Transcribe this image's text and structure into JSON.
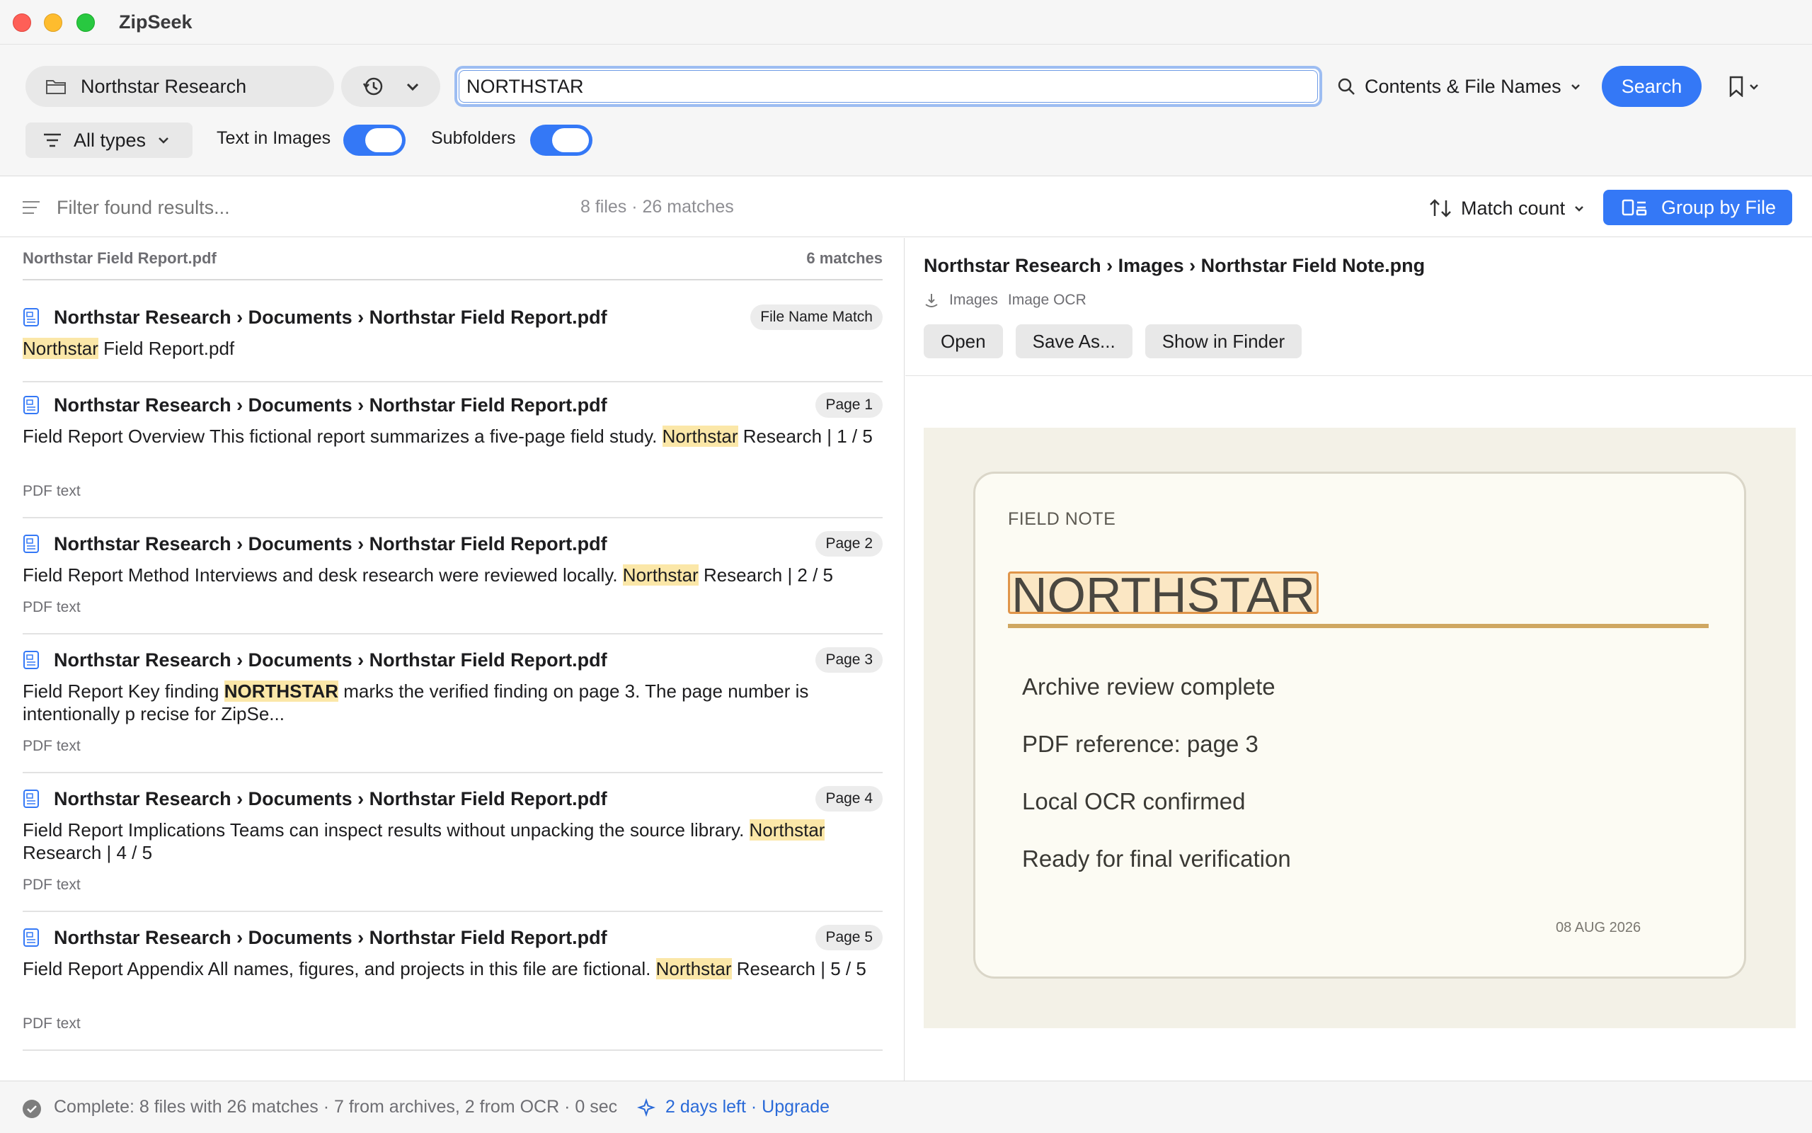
{
  "app": {
    "title": "ZipSeek"
  },
  "toolbar": {
    "location": "Northstar Research",
    "search_value": "NORTHSTAR",
    "scope_label": "Contents & File Names",
    "search_label": "Search",
    "types_label": "All types",
    "text_in_images_label": "Text in Images",
    "text_in_images_on": true,
    "subfolders_label": "Subfolders",
    "subfolders_on": true
  },
  "filter": {
    "placeholder": "Filter found results...",
    "summary": "8 files · 26 matches",
    "sort_label": "Match count",
    "group_label": "Group by File"
  },
  "results": {
    "group_file": "Northstar Field Report.pdf",
    "group_count": "6 matches",
    "items": [
      {
        "path": "Northstar Research › Documents › Northstar Field Report.pdf",
        "badge": "File Name Match",
        "pre": "",
        "hl": "Northstar",
        "post": " Field Report.pdf",
        "sub": ""
      },
      {
        "path": "Northstar Research › Documents › Northstar Field Report.pdf",
        "badge": "Page 1",
        "pre": "Field Report Overview This fictional report summarizes a five-page field study. ",
        "hl": "Northstar",
        "post": " Research | 1 / 5",
        "sub": "PDF text"
      },
      {
        "path": "Northstar Research › Documents › Northstar Field Report.pdf",
        "badge": "Page 2",
        "pre": "Field Report Method Interviews and desk research were reviewed locally. ",
        "hl": "Northstar",
        "post": " Research | 2 / 5",
        "sub": "PDF text"
      },
      {
        "path": "Northstar Research › Documents › Northstar Field Report.pdf",
        "badge": "Page 3",
        "pre": "Field Report Key finding ",
        "hl": "NORTHSTAR",
        "post": " marks the verified finding on page 3. The page number is intentionally p recise for ZipSe...",
        "sub": "PDF text"
      },
      {
        "path": "Northstar Research › Documents › Northstar Field Report.pdf",
        "badge": "Page 4",
        "pre": "Field Report Implications Teams can inspect results without unpacking the source library. ",
        "hl": "Northstar",
        "post": " Research | 4 / 5",
        "sub": "PDF text"
      },
      {
        "path": "Northstar Research › Documents › Northstar Field Report.pdf",
        "badge": "Page 5",
        "pre": "Field Report Appendix All names, figures, and projects in this file are fictional. ",
        "hl": "Northstar",
        "post": " Research | 5 / 5",
        "sub": "PDF text"
      }
    ]
  },
  "preview": {
    "path": "Northstar Research › Images › Northstar Field Note.png",
    "meta_folder": "Images",
    "meta_kind": "Image OCR",
    "open_label": "Open",
    "save_label": "Save As...",
    "finder_label": "Show in Finder",
    "note": {
      "label": "FIELD NOTE",
      "title": "NORTHSTAR",
      "lines": [
        "Archive review complete",
        "PDF reference: page 3",
        "Local OCR confirmed",
        "Ready for final verification"
      ],
      "date": "08 AUG 2026"
    }
  },
  "status": {
    "text": "Complete: 8 files with 26 matches · 7 from archives, 2 from OCR · 0 sec",
    "trial": "2 days left",
    "upgrade": "Upgrade"
  },
  "colors": {
    "accent": "#3478f6",
    "highlight": "#fbe7a8",
    "note_rule": "#cfa761"
  }
}
